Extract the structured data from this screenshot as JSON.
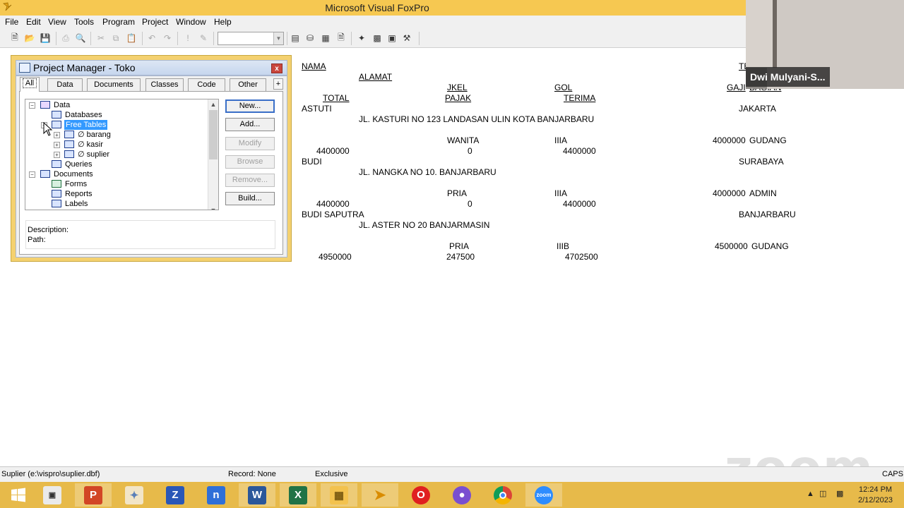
{
  "window": {
    "title": "Microsoft Visual FoxPro"
  },
  "menu": {
    "items": [
      "File",
      "Edit",
      "View",
      "Tools",
      "Program",
      "Project",
      "Window",
      "Help"
    ]
  },
  "toolbar": {
    "icons": [
      "new-file-icon",
      "open-folder-icon",
      "save-icon",
      "print-icon",
      "print-preview-icon",
      "cut-icon",
      "copy-icon",
      "paste-icon",
      "undo-icon",
      "redo-icon",
      "run-icon",
      "modify-icon",
      "command-window-icon",
      "data-session-icon",
      "properties-icon",
      "code-icon",
      "form-wizard-icon",
      "database-wizard-icon",
      "report-icon",
      "toolbox-icon"
    ],
    "combo_value": ""
  },
  "project_manager": {
    "title": "Project Manager - Toko",
    "close_label": "x",
    "tabs": [
      "All",
      "Data",
      "Documents",
      "Classes",
      "Code",
      "Other"
    ],
    "tab_more": "+",
    "tree": {
      "data": "Data",
      "databases": "Databases",
      "free_tables": "Free Tables",
      "barang": "barang",
      "kasir": "kasir",
      "suplier": "suplier",
      "queries": "Queries",
      "documents": "Documents",
      "forms": "Forms",
      "reports": "Reports",
      "labels": "Labels"
    },
    "buttons": {
      "new": "New...",
      "add": "Add...",
      "modify": "Modify",
      "browse": "Browse",
      "remove": "Remove...",
      "build": "Build..."
    },
    "description_label": "Description:",
    "path_label": "Path:"
  },
  "report": {
    "headers": {
      "nama": "NAMA",
      "alamat": "ALAMAT",
      "jkel": "JKEL",
      "gol": "GOL",
      "gaji": "GAJI",
      "bagian": "BAGIAN",
      "total": "TOTAL",
      "pajak": "PAJAK",
      "terima": "TERIMA",
      "tempat": "TE"
    },
    "rows": [
      {
        "nama": "ASTUTI",
        "kota": "JAKARTA",
        "alamat": "JL. KASTURI NO 123 LANDASAN ULIN KOTA BANJARBARU",
        "jkel": "WANITA",
        "gol": "IIIA",
        "gaji": "4000000",
        "bagian": "GUDANG",
        "total": "4400000",
        "pajak": "0",
        "terima": "4400000"
      },
      {
        "nama": "BUDI",
        "kota": "SURABAYA",
        "alamat": "JL. NANGKA NO 10. BANJARBARU",
        "jkel": "PRIA",
        "gol": "IIIA",
        "gaji": "4000000",
        "bagian": "ADMIN",
        "total": "4400000",
        "pajak": "0",
        "terima": "4400000"
      },
      {
        "nama": "BUDI SAPUTRA",
        "kota": "BANJARBARU",
        "alamat": "JL. ASTER NO 20 BANJARMASIN",
        "jkel": "PRIA",
        "gol": "IIIB",
        "gaji": "4500000",
        "bagian": "GUDANG",
        "total": "4950000",
        "pajak": "247500",
        "terima": "4702500"
      }
    ]
  },
  "video": {
    "participant_name": "Dwi Mulyani-S...",
    "watermark": "zoom"
  },
  "status": {
    "table": "Suplier (e:\\vispro\\suplier.dbf)",
    "record": "Record: None",
    "mode": "Exclusive",
    "caps": "CAPS"
  },
  "taskbar": {
    "apps": [
      "start-icon",
      "explorer-window-icon",
      "powerpoint-icon",
      "paint-icon",
      "scan-icon",
      "notes-icon",
      "word-icon",
      "excel-icon",
      "file-explorer-icon",
      "foxpro-icon",
      "opera-icon",
      "vpn-icon",
      "chrome-icon",
      "zoom-icon"
    ],
    "time": "12:24 PM",
    "date": "2/12/2023"
  },
  "colors": {
    "titlebar": "#f6c851",
    "taskbar": "#e7ba4a",
    "selection": "#3399ff"
  }
}
